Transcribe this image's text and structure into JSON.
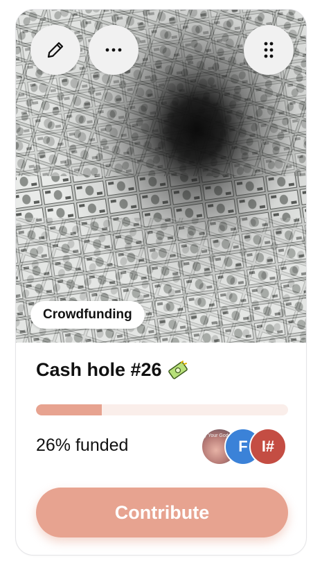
{
  "card": {
    "category_tag": "Crowdfunding",
    "title": "Cash hole #26",
    "funded_label": "26% funded",
    "progress_fraction": 0.26,
    "contribute_label": "Contribute",
    "hero_image": "money-vortex"
  },
  "toolbar": {
    "edit_icon": "pencil-icon",
    "more_icon": "ellipsis-icon",
    "drag_icon": "drag-handle-icon"
  },
  "contributors": [
    {
      "name": "photo-avatar",
      "initials": "",
      "caption": "y Your God",
      "color": "#b77b76"
    },
    {
      "name": "initial-avatar",
      "initials": "F",
      "color": "#3b82d8"
    },
    {
      "name": "initial-avatar",
      "initials": "I#",
      "color": "#c44d43"
    }
  ],
  "colors": {
    "accent": "#e7a390",
    "progress_track": "#faeeea",
    "text": "#111111"
  }
}
